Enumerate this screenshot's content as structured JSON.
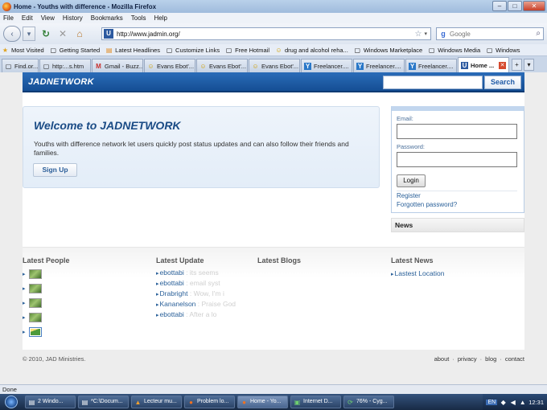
{
  "window": {
    "title": "Home - Youths with difference - Mozilla Firefox",
    "controls": {
      "minimize": "–",
      "maximize": "□",
      "close": "✕"
    }
  },
  "menu": [
    "File",
    "Edit",
    "View",
    "History",
    "Bookmarks",
    "Tools",
    "Help"
  ],
  "nav": {
    "back": "‹",
    "dropdown": "▾",
    "reload": "↻",
    "stop": "✕",
    "home": "⌂",
    "site_badge": "U",
    "url": "http://www.jadmin.org/",
    "star": "☆",
    "url_drop": "▾",
    "search_engine": "g",
    "search_placeholder": "Google",
    "search_icon": "⌕"
  },
  "bookmarks": [
    {
      "label": "Most Visited",
      "icon": "★"
    },
    {
      "label": "Getting Started",
      "icon": "▢"
    },
    {
      "label": "Latest Headlines",
      "icon": "▤"
    },
    {
      "label": "Customize Links",
      "icon": "▢"
    },
    {
      "label": "Free Hotmail",
      "icon": "▢"
    },
    {
      "label": "drug and alcohol reha...",
      "icon": "☺"
    },
    {
      "label": "Windows Marketplace",
      "icon": "▢"
    },
    {
      "label": "Windows Media",
      "icon": "▢"
    },
    {
      "label": "Windows",
      "icon": "▢"
    }
  ],
  "tabs": [
    {
      "label": "Find.or...",
      "icon": "▢"
    },
    {
      "label": "http:...s.htm",
      "icon": "▢"
    },
    {
      "label": "Gmail - Buzz...",
      "icon": "M"
    },
    {
      "label": "Evans Ebot'...",
      "icon": "☺"
    },
    {
      "label": "Evans Ebot'...",
      "icon": "☺"
    },
    {
      "label": "Evans Ebot'...",
      "icon": "☺"
    },
    {
      "label": "Freelancer....",
      "icon": "Y"
    },
    {
      "label": "Freelancer....",
      "icon": "Y"
    },
    {
      "label": "Freelancer....",
      "icon": "Y"
    },
    {
      "label": "Home ...",
      "icon": "U",
      "active": true
    }
  ],
  "tab_controls": {
    "new": "+",
    "list": "▾",
    "close": "✕"
  },
  "site": {
    "logo": "JADNETWORK",
    "search_button": "Search",
    "welcome_title": "Welcome to JADNETWORK",
    "welcome_text": "Youths with difference network let users quickly post status updates and can also follow their friends and families.",
    "signup": "Sign Up",
    "login": {
      "email_label": "Email:",
      "password_label": "Password:",
      "button": "Login",
      "register": "Register",
      "forgot": "Forgotten password?"
    },
    "news_box": "News",
    "columns": {
      "people": "Latest People",
      "update": "Latest Update",
      "blogs": "Latest Blogs",
      "news": "Latest News"
    },
    "updates": [
      {
        "who": "ebottabi",
        "msg": " : its seems"
      },
      {
        "who": "ebottabi",
        "msg": " : email syst"
      },
      {
        "who": "Drabright",
        "msg": " : Wow, I'm i"
      },
      {
        "who": "Kananelson",
        "msg": " : Praise God"
      },
      {
        "who": "ebottabi",
        "msg": " : After a lo"
      }
    ],
    "news_items": [
      "Lastest Location"
    ],
    "arrow": "▸",
    "copyright": "© 2010, JAD Ministries.",
    "footer_links": [
      "about",
      "privacy",
      "blog",
      "contact"
    ],
    "footer_sep": "·"
  },
  "status": "Done",
  "taskbar": {
    "items": [
      {
        "label": "2 Windo...",
        "icon": "▤"
      },
      {
        "label": "*C:\\Docum...",
        "icon": "▤"
      },
      {
        "label": "Lecteur mu...",
        "icon": "▲"
      },
      {
        "label": "Problem lo...",
        "icon": "●"
      },
      {
        "label": "Home - Yo...",
        "icon": "●",
        "active": true
      },
      {
        "label": "Internet D...",
        "icon": "▣"
      },
      {
        "label": "76% - Cyg...",
        "icon": "⟳"
      }
    ],
    "lang": "EN",
    "time": "12:31"
  },
  "colors": {
    "header_blue": "#1f5aa6",
    "link_blue": "#2a6099",
    "welcome_title": "#1a4b85"
  }
}
